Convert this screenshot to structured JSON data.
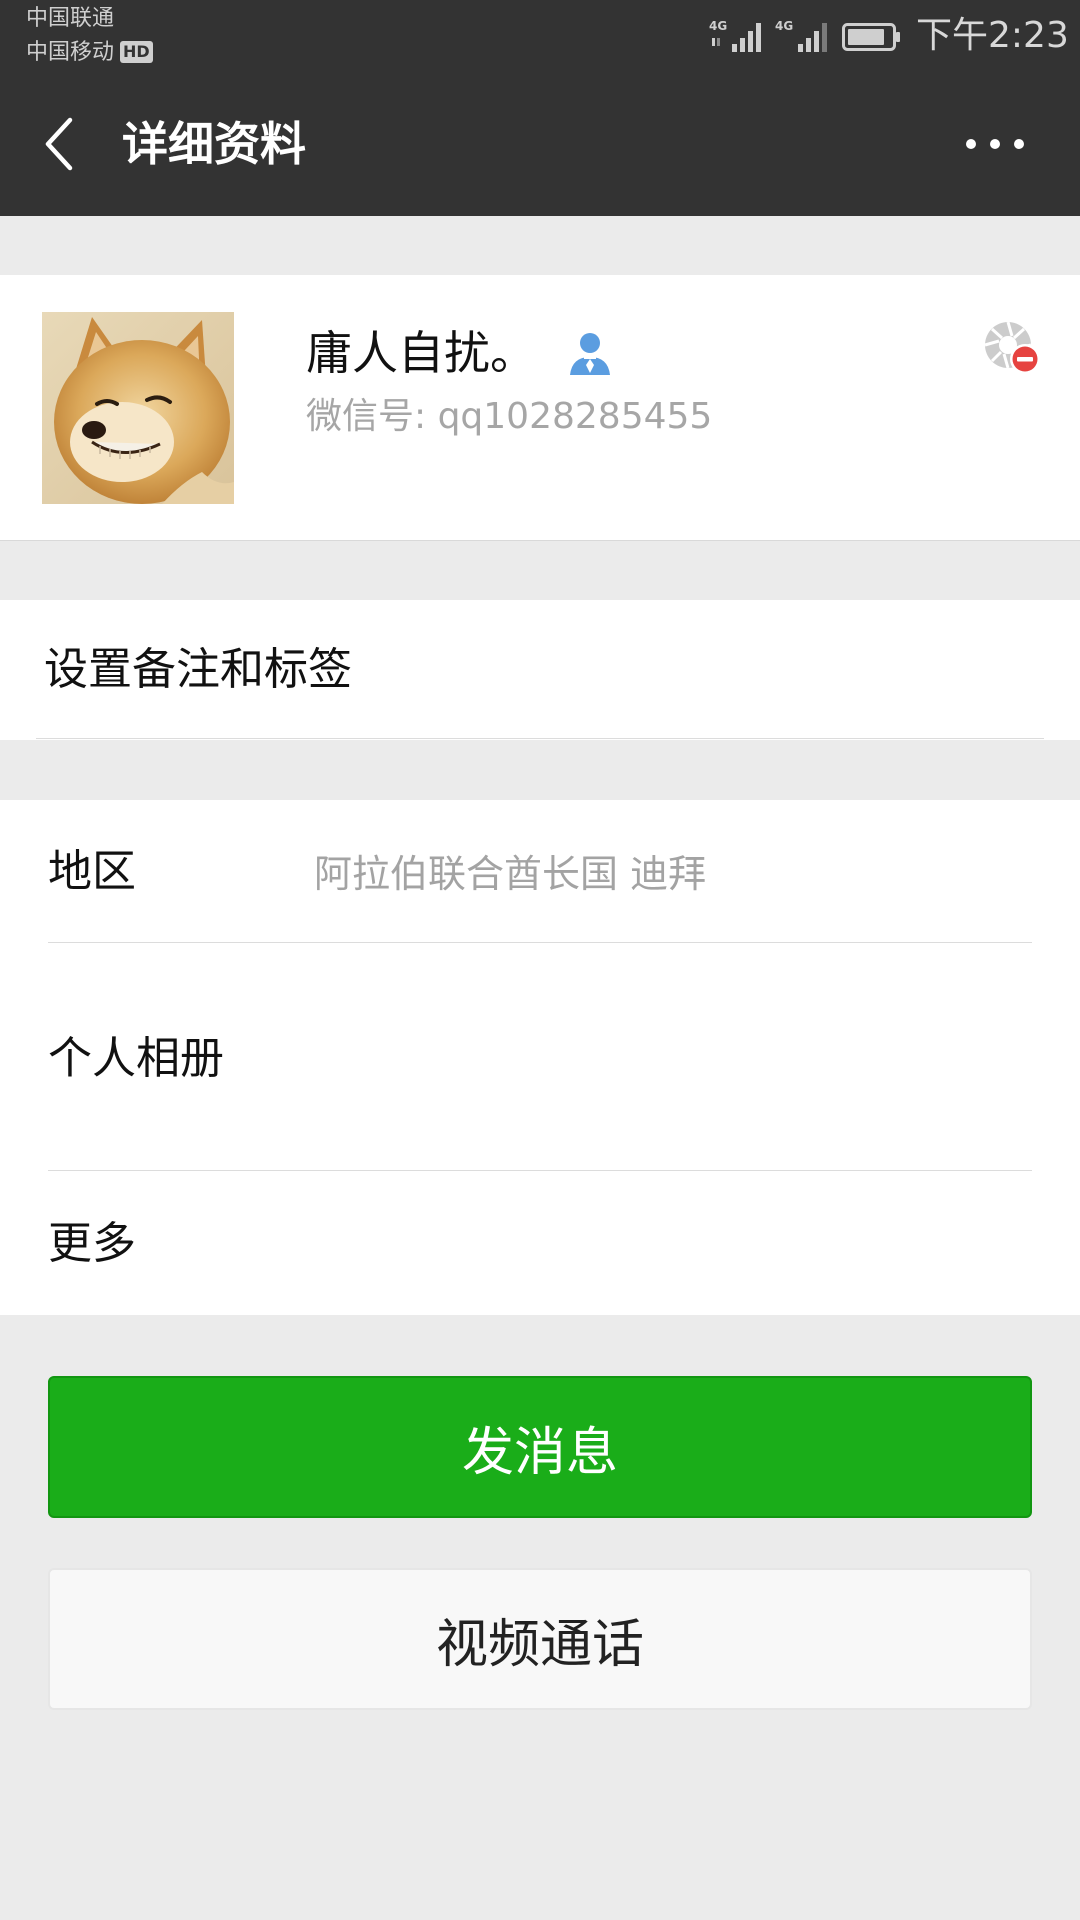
{
  "status_bar": {
    "carrier_1": "中国联通",
    "carrier_2": "中国移动",
    "hd_badge": "HD",
    "network_1": "4G",
    "network_2": "4G",
    "time": "下午2:23"
  },
  "title_bar": {
    "back_icon": "chevron-left-icon",
    "title": "详细资料",
    "more_icon": "more-horizontal-icon"
  },
  "profile": {
    "nickname": "庸人自扰。",
    "gender_icon": "male-user-icon",
    "wechat_id": "微信号: qq1028285455",
    "moments_block_icon": "moments-blocked-icon"
  },
  "remark_cell": {
    "label": "设置备注和标签"
  },
  "info_cells": {
    "region_label": "地区",
    "region_value": "阿拉伯联合酋长国  迪拜",
    "album_label": "个人相册",
    "more_label": "更多"
  },
  "buttons": {
    "send_message": "发消息",
    "video_call": "视频通话"
  },
  "colors": {
    "header_bg": "#333333",
    "page_bg": "#ebebeb",
    "primary_green": "#1aad19",
    "secondary_text": "#a6a6a6",
    "block_badge_red": "#e64340",
    "gender_blue": "#5b9de0"
  }
}
